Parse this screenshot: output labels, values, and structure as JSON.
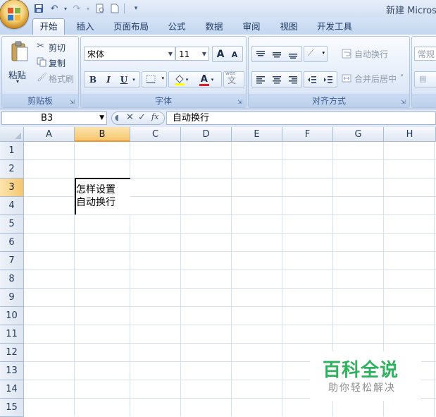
{
  "window": {
    "title": "新建 Microsoft",
    "quick_access": [
      "save-icon",
      "undo-icon",
      "redo-icon",
      "print-preview-icon",
      "new-icon",
      "customize-icon"
    ]
  },
  "tabs": [
    {
      "label": "开始",
      "active": true
    },
    {
      "label": "插入",
      "active": false
    },
    {
      "label": "页面布局",
      "active": false
    },
    {
      "label": "公式",
      "active": false
    },
    {
      "label": "数据",
      "active": false
    },
    {
      "label": "审阅",
      "active": false
    },
    {
      "label": "视图",
      "active": false
    },
    {
      "label": "开发工具",
      "active": false
    }
  ],
  "ribbon": {
    "clipboard": {
      "label": "剪贴板",
      "paste": "粘贴",
      "cut": "剪切",
      "copy": "复制",
      "format_painter": "格式刷"
    },
    "font": {
      "label": "字体",
      "font_name": "宋体",
      "font_size": "11",
      "grow_font": "A",
      "shrink_font": "A",
      "bold": "B",
      "italic": "I",
      "underline": "U",
      "font_color_glyph": "A",
      "phonetic_glyph": "wén",
      "font_color": "#e02020",
      "highlight_color": "#ffff00"
    },
    "alignment": {
      "label": "对齐方式",
      "wrap_text": "自动换行",
      "merge_center": "合并后居中"
    },
    "number": {
      "format": "常规"
    }
  },
  "formula_bar": {
    "name_box": "B3",
    "fx": "fx",
    "content": "自动换行"
  },
  "sheet": {
    "columns": [
      "A",
      "B",
      "C",
      "D",
      "E",
      "F",
      "G",
      "H"
    ],
    "rows": [
      "1",
      "2",
      "3",
      "4",
      "5",
      "6",
      "7",
      "8",
      "9",
      "10",
      "11",
      "12",
      "13",
      "14",
      "15"
    ],
    "selected_column": "B",
    "selected_row": "3",
    "cell_b3_text": "怎样设置\n自动换行"
  },
  "watermark": {
    "title": "百科全说",
    "subtitle": "助你轻松解决"
  }
}
